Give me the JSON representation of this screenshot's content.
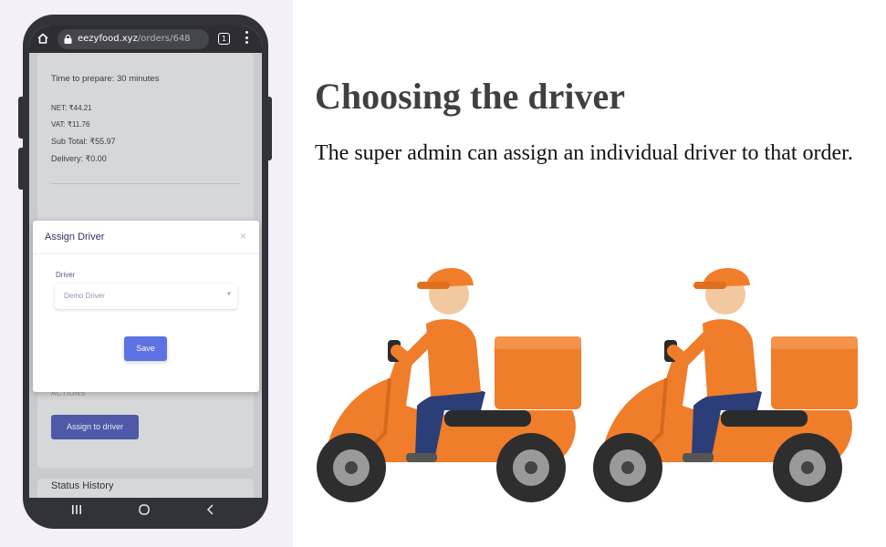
{
  "browser": {
    "url_domain": "eezyfood.xyz",
    "url_path": "/orders/648",
    "tab_count": "1"
  },
  "order": {
    "prepare_time": "Time to prepare: 30 minutes",
    "net": "NET: ₹44.21",
    "vat": "VAT: ₹11.76",
    "subtotal": "Sub Total: ₹55.97",
    "delivery": "Delivery: ₹0.00"
  },
  "actions": {
    "section_label": "ACTIONS",
    "assign_button": "Assign to driver"
  },
  "status_history": {
    "title": "Status History"
  },
  "modal": {
    "title": "Assign Driver",
    "close": "×",
    "driver_label": "Driver",
    "driver_selected": "Demo Driver",
    "save_label": "Save"
  },
  "slide": {
    "title": "Choosing the driver",
    "description": "The super admin can assign an individual driver to that order."
  },
  "colors": {
    "scooter": "#f07d2a",
    "modal_button": "#5e72e4",
    "assign_button": "#4e5aa8",
    "phone_frame": "#32323a"
  }
}
